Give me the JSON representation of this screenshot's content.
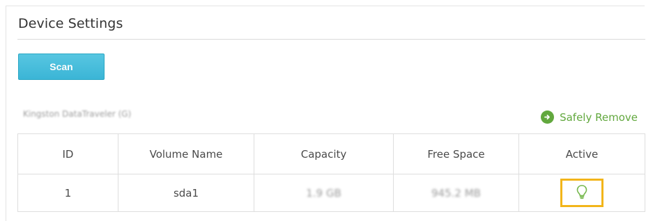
{
  "page": {
    "title": "Device Settings"
  },
  "toolbar": {
    "scan_label": "Scan"
  },
  "device": {
    "name": "Kingston DataTraveler (G)",
    "safely_remove_label": "Safely Remove",
    "safely_remove_icon": "arrow-circle-icon"
  },
  "table": {
    "headers": [
      "ID",
      "Volume Name",
      "Capacity",
      "Free Space",
      "Active"
    ],
    "rows": [
      {
        "id": "1",
        "volume_name": "sda1",
        "capacity": "1.9 GB",
        "free_space": "945.2 MB",
        "active_icon": "lightbulb-icon"
      }
    ]
  },
  "colors": {
    "accent": "#3bb5d6",
    "safely_remove": "#62a83e",
    "active_highlight": "#f2b51a"
  }
}
